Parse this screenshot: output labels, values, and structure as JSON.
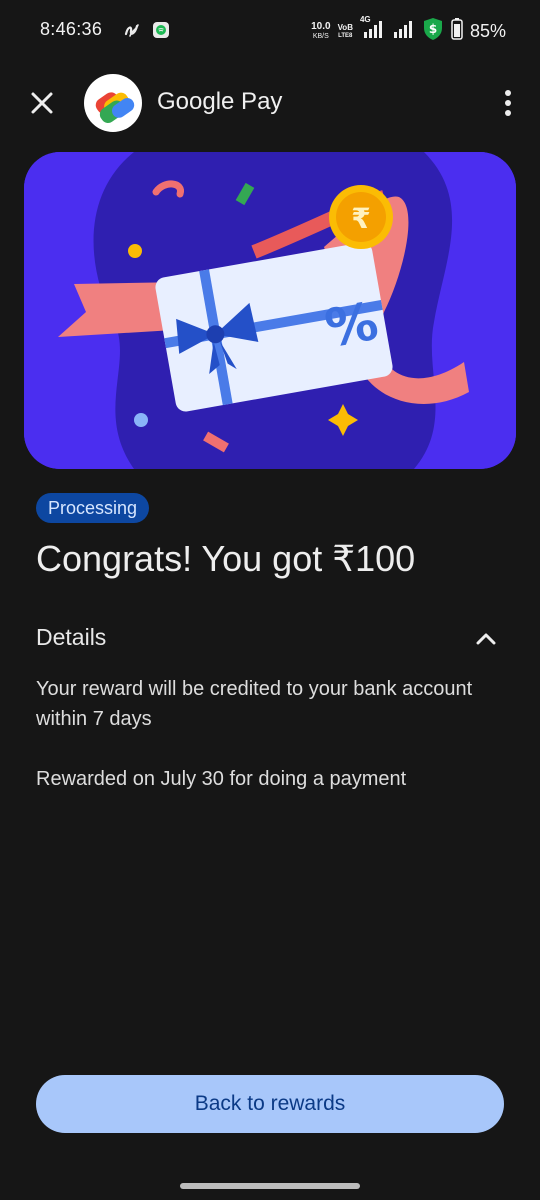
{
  "status_bar": {
    "time": "8:46:36",
    "net_speed_value": "10.0",
    "net_speed_unit": "KB/S",
    "volte_top": "VoB",
    "volte_bottom": "LTE8",
    "network_type": "4G",
    "battery_percent": "85%"
  },
  "app_bar": {
    "title": "Google Pay",
    "icons": [
      "close-icon",
      "google-pay-logo",
      "more-vert-icon"
    ]
  },
  "reward": {
    "status": "Processing",
    "headline": "Congrats! You got ₹100",
    "coin_symbol": "₹",
    "card_symbol": "%"
  },
  "details": {
    "title": "Details",
    "expanded": true,
    "line1": "Your reward will be credited to your bank account within 7 days",
    "line2": "Rewarded on July 30 for doing a payment"
  },
  "actions": {
    "back_label": "Back to rewards"
  },
  "colors": {
    "background": "#161616",
    "hero_bg": "#4b2ef0",
    "badge_bg": "#0d47a1",
    "button_bg": "#a8c7fa",
    "button_text": "#0b3a86"
  }
}
